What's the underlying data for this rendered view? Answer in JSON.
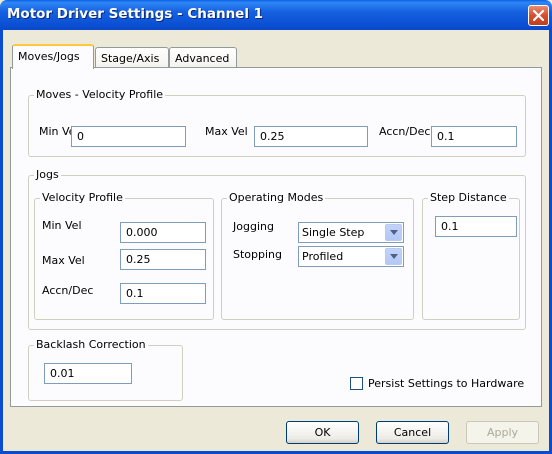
{
  "window": {
    "title": "Motor Driver Settings - Channel 1",
    "close_icon": "close-icon"
  },
  "tabs": [
    {
      "label": "Moves/Jogs",
      "active": true
    },
    {
      "label": "Stage/Axis",
      "active": false
    },
    {
      "label": "Advanced",
      "active": false
    }
  ],
  "moves": {
    "group_label": "Moves - Velocity Profile",
    "min_vel_label": "Min Vel",
    "min_vel_value": "0",
    "max_vel_label": "Max Vel",
    "max_vel_value": "0.25",
    "accn_label": "Accn/Dec",
    "accn_value": "0.1"
  },
  "jogs": {
    "group_label": "Jogs",
    "velocity": {
      "group_label": "Velocity Profile",
      "min_vel_label": "Min Vel",
      "min_vel_value": "0.000",
      "max_vel_label": "Max Vel",
      "max_vel_value": "0.25",
      "accn_label": "Accn/Dec",
      "accn_value": "0.1"
    },
    "modes": {
      "group_label": "Operating Modes",
      "jogging_label": "Jogging",
      "jogging_value": "Single Step",
      "stopping_label": "Stopping",
      "stopping_value": "Profiled"
    },
    "step": {
      "group_label": "Step Distance",
      "value": "0.1"
    }
  },
  "backlash": {
    "group_label": "Backlash Correction",
    "value": "0.01"
  },
  "persist": {
    "label": "Persist Settings to Hardware",
    "checked": false
  },
  "buttons": {
    "ok": "OK",
    "cancel": "Cancel",
    "apply": "Apply"
  }
}
